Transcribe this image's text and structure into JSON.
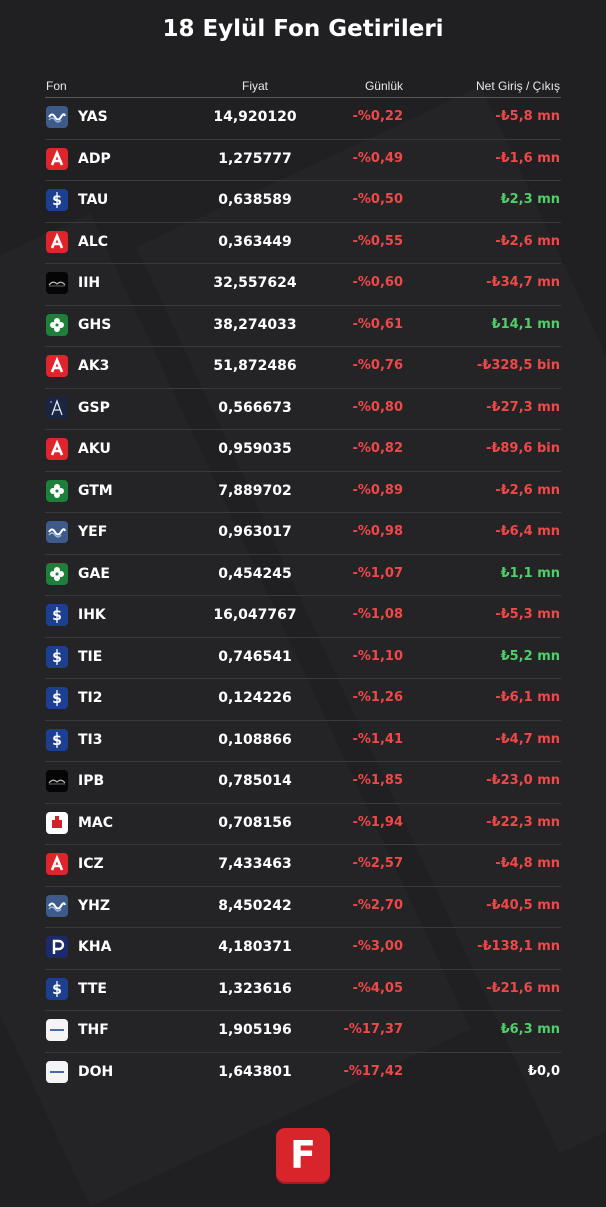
{
  "title": "18 Eylül Fon Getirileri",
  "headers": {
    "fon": "Fon",
    "price": "Fiyat",
    "daily": "Günlük",
    "net": "Net Giriş / Çıkış"
  },
  "colors": {
    "negative": "#f04848",
    "positive": "#4fcf68",
    "background": "#202022",
    "brand": "#d8242b"
  },
  "rows": [
    {
      "code": "YAS",
      "logo": "wave-logo-icon",
      "price": "14,920120",
      "daily": "-%0,22",
      "net": "-₺5,8 mn",
      "net_sign": "neg"
    },
    {
      "code": "ADP",
      "logo": "ak-logo-icon",
      "price": "1,275777",
      "daily": "-%0,49",
      "net": "-₺1,6 mn",
      "net_sign": "neg"
    },
    {
      "code": "TAU",
      "logo": "isbank-logo-icon",
      "price": "0,638589",
      "daily": "-%0,50",
      "net": "₺2,3 mn",
      "net_sign": "pos"
    },
    {
      "code": "ALC",
      "logo": "ak-logo-icon",
      "price": "0,363449",
      "daily": "-%0,55",
      "net": "-₺2,6 mn",
      "net_sign": "neg"
    },
    {
      "code": "IIH",
      "logo": "dark-logo-icon",
      "price": "32,557624",
      "daily": "-%0,60",
      "net": "-₺34,7 mn",
      "net_sign": "neg"
    },
    {
      "code": "GHS",
      "logo": "clover-logo-icon",
      "price": "38,274033",
      "daily": "-%0,61",
      "net": "₺14,1 mn",
      "net_sign": "pos"
    },
    {
      "code": "AK3",
      "logo": "ak-logo-icon",
      "price": "51,872486",
      "daily": "-%0,76",
      "net": "-₺328,5 bin",
      "net_sign": "neg"
    },
    {
      "code": "GSP",
      "logo": "a-letter-logo-icon",
      "price": "0,566673",
      "daily": "-%0,80",
      "net": "-₺27,3 mn",
      "net_sign": "neg"
    },
    {
      "code": "AKU",
      "logo": "ak-logo-icon",
      "price": "0,959035",
      "daily": "-%0,82",
      "net": "-₺89,6 bin",
      "net_sign": "neg"
    },
    {
      "code": "GTM",
      "logo": "clover-logo-icon",
      "price": "7,889702",
      "daily": "-%0,89",
      "net": "-₺2,6 mn",
      "net_sign": "neg"
    },
    {
      "code": "YEF",
      "logo": "wave-logo-icon",
      "price": "0,963017",
      "daily": "-%0,98",
      "net": "-₺6,4 mn",
      "net_sign": "neg"
    },
    {
      "code": "GAE",
      "logo": "clover-logo-icon",
      "price": "0,454245",
      "daily": "-%1,07",
      "net": "₺1,1 mn",
      "net_sign": "pos"
    },
    {
      "code": "IHK",
      "logo": "isbank-logo-icon",
      "price": "16,047767",
      "daily": "-%1,08",
      "net": "-₺5,3 mn",
      "net_sign": "neg"
    },
    {
      "code": "TIE",
      "logo": "isbank-logo-icon",
      "price": "0,746541",
      "daily": "-%1,10",
      "net": "₺5,2 mn",
      "net_sign": "pos"
    },
    {
      "code": "TI2",
      "logo": "isbank-logo-icon",
      "price": "0,124226",
      "daily": "-%1,26",
      "net": "-₺6,1 mn",
      "net_sign": "neg"
    },
    {
      "code": "TI3",
      "logo": "isbank-logo-icon",
      "price": "0,108866",
      "daily": "-%1,41",
      "net": "-₺4,7 mn",
      "net_sign": "neg"
    },
    {
      "code": "IPB",
      "logo": "dark-logo-icon",
      "price": "0,785014",
      "daily": "-%1,85",
      "net": "-₺23,0 mn",
      "net_sign": "neg"
    },
    {
      "code": "MAC",
      "logo": "white-red-logo-icon",
      "price": "0,708156",
      "daily": "-%1,94",
      "net": "-₺22,3 mn",
      "net_sign": "neg"
    },
    {
      "code": "ICZ",
      "logo": "ak-logo-icon",
      "price": "7,433463",
      "daily": "-%2,57",
      "net": "-₺4,8 mn",
      "net_sign": "neg"
    },
    {
      "code": "YHZ",
      "logo": "wave-logo-icon",
      "price": "8,450242",
      "daily": "-%2,70",
      "net": "-₺40,5 mn",
      "net_sign": "neg"
    },
    {
      "code": "KHA",
      "logo": "p-letter-logo-icon",
      "price": "4,180371",
      "daily": "-%3,00",
      "net": "-₺138,1 mn",
      "net_sign": "neg"
    },
    {
      "code": "TTE",
      "logo": "isbank-logo-icon",
      "price": "1,323616",
      "daily": "-%4,05",
      "net": "-₺21,6 mn",
      "net_sign": "neg"
    },
    {
      "code": "THF",
      "logo": "white-logo-icon",
      "price": "1,905196",
      "daily": "-%17,37",
      "net": "₺6,3 mn",
      "net_sign": "pos"
    },
    {
      "code": "DOH",
      "logo": "white-logo-icon",
      "price": "1,643801",
      "daily": "-%17,42",
      "net": "₺0,0",
      "net_sign": "zero"
    }
  ],
  "footer": {
    "brand_letter": "F"
  }
}
